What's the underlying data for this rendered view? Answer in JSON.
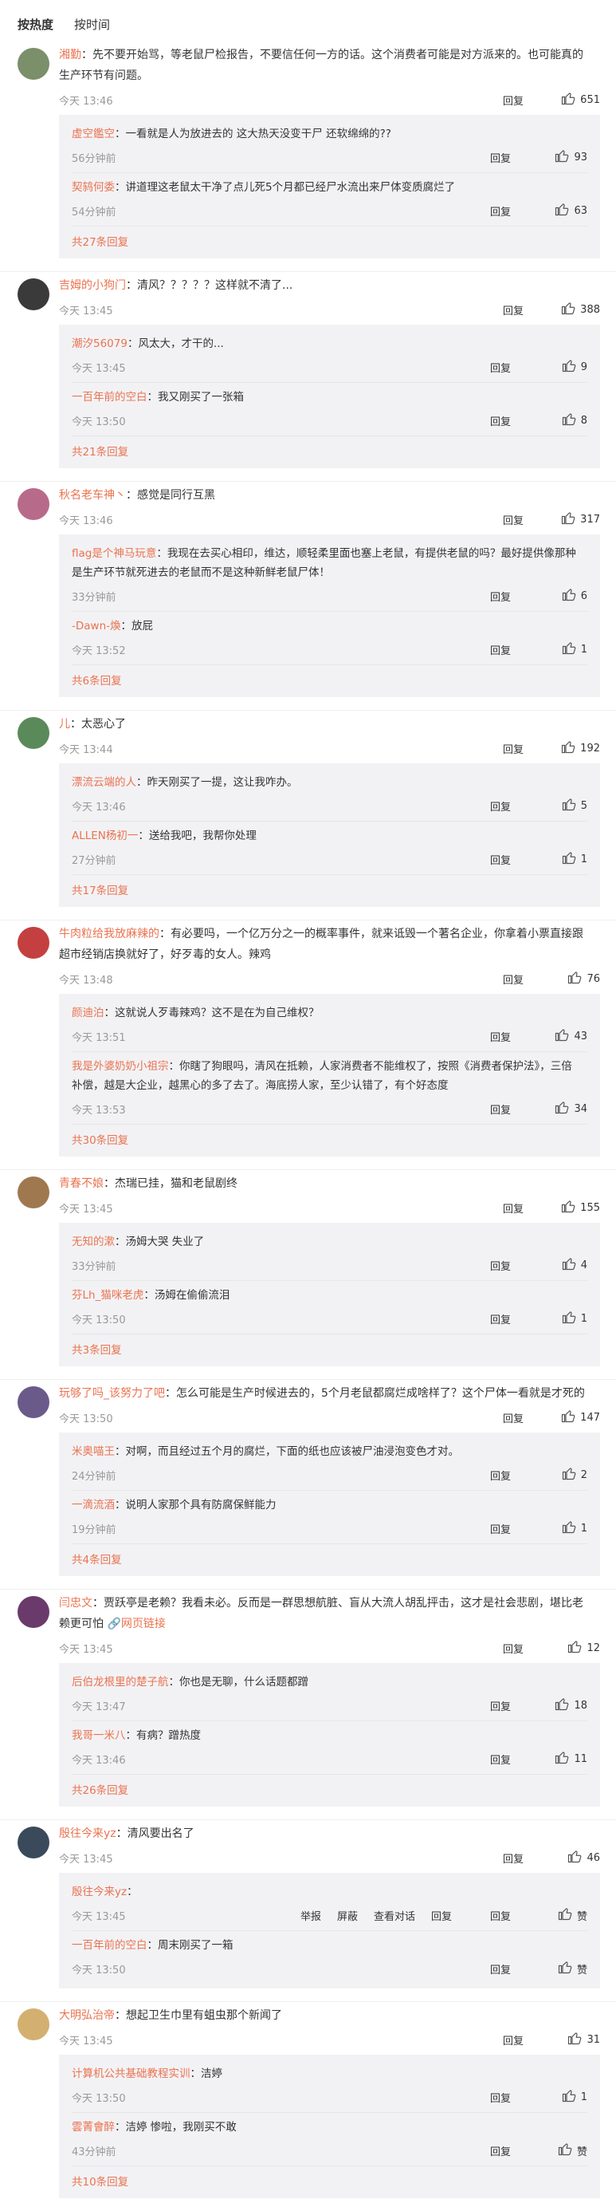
{
  "sort": {
    "hot": "按热度",
    "time": "按时间"
  },
  "labels": {
    "reply": "回复",
    "more_suffix": "条回复"
  },
  "comments": [
    {
      "user": "湘勤",
      "text": "：先不要开始骂，等老鼠尸检报告，不要信任何一方的话。这个消费者可能是对方派来的。也可能真的生产环节有问题。",
      "time": "今天 13:46",
      "likes": "651",
      "avatar_color": "#7a8f6a",
      "replies": [
        {
          "user": "虚空鑑空",
          "text": "：一看就是人为放进去的 这大热天没变干尸 还软绵绵的??",
          "time": "56分钟前",
          "likes": "93"
        },
        {
          "user": "契鸫何委",
          "text": "：讲道理这老鼠太干净了点儿死5个月都已经尸水流出来尸体变质腐烂了",
          "time": "54分钟前",
          "likes": "63"
        }
      ],
      "more": "共27条回复"
    },
    {
      "user": "吉姆的小狗门",
      "text": "：清风？？？？？这样就不清了...",
      "time": "今天 13:45",
      "likes": "388",
      "avatar_color": "#3a3a3a",
      "replies": [
        {
          "user": "潮汐56079",
          "text": "：风太大，才干的...",
          "time": "今天 13:45",
          "likes": "9"
        },
        {
          "user": "一百年前的空白",
          "text": "：我又刚买了一张箱",
          "time": "今天 13:50",
          "likes": "8"
        }
      ],
      "more": "共21条回复"
    },
    {
      "user": "秋名老车神丶",
      "text": "：感觉是同行互黑",
      "time": "今天 13:46",
      "likes": "317",
      "avatar_color": "#b86a8a",
      "replies": [
        {
          "user": "flag是个神马玩意",
          "text": "：我现在去买心相印，维达，顺轻柔里面也塞上老鼠，有提供老鼠的吗？最好提供像那种是生产环节就死进去的老鼠而不是这种新鲜老鼠尸体！",
          "time": "33分钟前",
          "likes": "6"
        },
        {
          "user": "-Dawn-煥",
          "text": "：放屁",
          "time": "今天 13:52",
          "likes": "1"
        }
      ],
      "more": "共6条回复"
    },
    {
      "user": "儿",
      "text": "：太恶心了",
      "time": "今天 13:44",
      "likes": "192",
      "avatar_color": "#5a8a5a",
      "replies": [
        {
          "user": "漂流云端的人",
          "text": "：昨天刚买了一提，这让我咋办。",
          "time": "今天 13:46",
          "likes": "5"
        },
        {
          "user": "ALLEN杨初一",
          "text": "：送给我吧，我帮你处理",
          "time": "27分钟前",
          "likes": "1"
        }
      ],
      "more": "共17条回复"
    },
    {
      "user": "牛肉粒给我放麻辣的",
      "text": "：有必要吗，一个亿万分之一的概率事件，就来诋毁一个著名企业，你拿着小票直接跟超市经销店换就好了，好歹毒的女人。辣鸡",
      "time": "今天 13:48",
      "likes": "76",
      "avatar_color": "#c44040",
      "replies": [
        {
          "user": "颜迪泊",
          "text": "：这就说人歹毒辣鸡？这不是在为自己维权？",
          "time": "今天 13:51",
          "likes": "43"
        },
        {
          "user": "我是外婆奶奶小祖宗",
          "text": "：你瞎了狗眼吗，清风在抵赖，人家消费者不能维权了，按照《消费者保护法》，三倍补偿，越是大企业，越黑心的多了去了。海底捞人家，至少认错了，有个好态度",
          "time": "今天 13:53",
          "likes": "34"
        }
      ],
      "more": "共30条回复"
    },
    {
      "user": "青春不娘",
      "text": "：杰瑞已挂，猫和老鼠剧终",
      "time": "今天 13:45",
      "likes": "155",
      "avatar_color": "#a07850",
      "replies": [
        {
          "user": "无知的漱",
          "text": "：汤姆大哭  失业了",
          "time": "33分钟前",
          "likes": "4"
        },
        {
          "user": "芬Lh_猫咪老虎",
          "text": "：汤姆在偷偷流泪",
          "time": "今天 13:50",
          "likes": "1"
        }
      ],
      "more": "共3条回复"
    },
    {
      "user": "玩够了吗_该努力了吧",
      "text": "：怎么可能是生产时候进去的，5个月老鼠都腐烂成啥样了？这个尸体一看就是才死的",
      "time": "今天 13:50",
      "likes": "147",
      "avatar_color": "#6a5a8a",
      "replies": [
        {
          "user": "米奥喵王",
          "text": "：对啊，而且经过五个月的腐烂，下面的纸也应该被尸油浸泡变色才对。",
          "time": "24分钟前",
          "likes": "2"
        },
        {
          "user": "一滴流酒",
          "text": "：说明人家那个具有防腐保鲜能力",
          "time": "19分钟前",
          "likes": "1"
        }
      ],
      "more": "共4条回复"
    },
    {
      "user": "闫忠文",
      "text": "：贾跃亭是老赖？我看未必。反而是一群思想航脏、盲从大流人胡乱抨击，这才是社会悲剧，堪比老赖更可怕",
      "link": "网页链接",
      "time": "今天 13:45",
      "likes": "12",
      "avatar_color": "#6a3a6a",
      "replies": [
        {
          "user": "后伯龙根里的楚子航",
          "text": "：你也是无聊，什么话题都蹭",
          "time": "今天 13:47",
          "likes": "18"
        },
        {
          "user": "我哥一米八",
          "text": "：有病？蹭热度",
          "time": "今天 13:46",
          "likes": "11"
        }
      ],
      "more": "共26条回复"
    },
    {
      "user": "殷往今来yz",
      "text": "：清风要出名了",
      "time": "今天 13:45",
      "likes": "46",
      "avatar_color": "#3a4a5a",
      "replies": [
        {
          "user": "殷往今来yz",
          "text": "：",
          "time": "今天 13:45",
          "likes": "赞",
          "actions": [
            "举报",
            "屏蔽",
            "查看对话",
            "回复"
          ]
        },
        {
          "user": "一百年前的空白",
          "text": "：周末刚买了一箱",
          "time": "今天 13:50",
          "likes": "赞"
        }
      ],
      "more": ""
    },
    {
      "user": "大明弘治帝",
      "text": "：想起卫生巾里有蛆虫那个新闻了",
      "time": "今天 13:45",
      "likes": "31",
      "avatar_color": "#d4b070",
      "replies": [
        {
          "user": "计算机公共基础教程实训",
          "text": "：洁婷",
          "time": "今天 13:50",
          "likes": "1"
        },
        {
          "user": "雲菁會醉",
          "text": "：洁婷 惨啦，我刚买不敢",
          "time": "43分钟前",
          "likes": "赞"
        }
      ],
      "more": "共10条回复"
    }
  ]
}
